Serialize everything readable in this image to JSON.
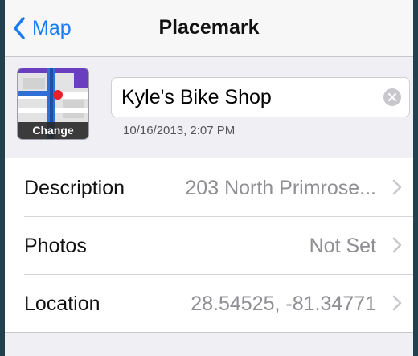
{
  "nav": {
    "back_label": "Map",
    "title": "Placemark"
  },
  "header": {
    "thumbnail_button_label": "Change",
    "name_value": "Kyle's Bike Shop",
    "timestamp": "10/16/2013, 2:07 PM"
  },
  "rows": [
    {
      "label": "Description",
      "value": "203 North Primrose..."
    },
    {
      "label": "Photos",
      "value": "Not Set"
    },
    {
      "label": "Location",
      "value": "28.54525, -81.34771"
    }
  ],
  "colors": {
    "accent": "#1a7cf5",
    "background": "#efeff4",
    "outer": "#22414f"
  },
  "icons": {
    "back": "chevron-left-icon",
    "clear": "clear-x-icon",
    "disclosure": "chevron-right-icon",
    "map_pin": "map-pin-icon"
  }
}
